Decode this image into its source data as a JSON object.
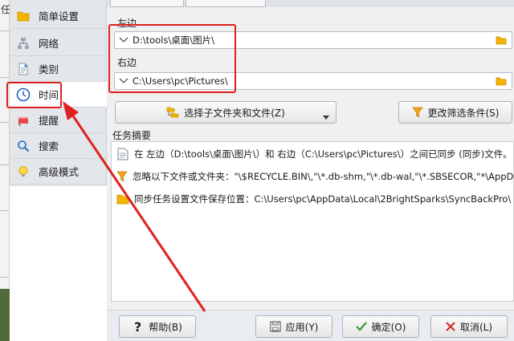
{
  "background_window": {
    "title_fragment": "任"
  },
  "sidebar": {
    "items": [
      {
        "label": "简单设置",
        "icon": "folder-icon"
      },
      {
        "label": "网络",
        "icon": "network-icon"
      },
      {
        "label": "类别",
        "icon": "category-icon"
      },
      {
        "label": "时间",
        "icon": "clock-icon"
      },
      {
        "label": "提醒",
        "icon": "alert-icon"
      },
      {
        "label": "搜索",
        "icon": "search-icon"
      },
      {
        "label": "高级模式",
        "icon": "lightbulb-icon"
      }
    ],
    "active_index": 3
  },
  "left": {
    "label": "左边",
    "path": "D:\\tools\\桌面\\图片\\"
  },
  "right": {
    "label": "右边",
    "path": "C:\\Users\\pc\\Pictures\\"
  },
  "buttons": {
    "select_subfolders": "选择子文件夹和文件(Z)",
    "change_filter": "更改筛选条件(S)"
  },
  "summary": {
    "title": "任务摘要",
    "rows": [
      {
        "text": "在 左边（D:\\tools\\桌面\\图片\\）和 右边（C:\\Users\\pc\\Pictures\\）之间已同步 (同步)文件。",
        "icon": "doc-icon"
      },
      {
        "text": "忽略以下文件或文件夹：\"\\$RECYCLE.BIN\\,\"\\*.db-shm,\"\\*.db-wal,\"\\*.SBSECOR,\"*\\AppData\\Local\\Temporar...",
        "icon": "filter-icon"
      },
      {
        "text": "同步任务设置文件保存位置：C:\\Users\\pc\\AppData\\Local\\2BrightSparks\\SyncBackPro\\",
        "icon": "folder-icon"
      }
    ]
  },
  "footer": {
    "help": "帮助(B)",
    "apply": "应用(Y)",
    "ok": "确定(O)",
    "cancel": "取消(L)"
  },
  "colors": {
    "highlight": "#e02020",
    "folder": "#f4b400",
    "accent_blue": "#1f5fbf"
  }
}
